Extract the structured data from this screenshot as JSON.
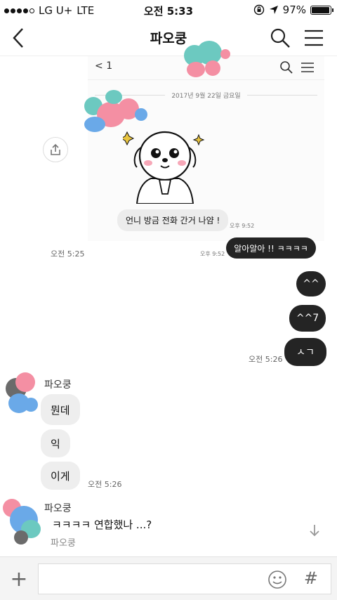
{
  "status": {
    "carrier": "LG U+",
    "network": "LTE",
    "time": "오전 5:33",
    "battery": "97%",
    "battery_level": 0.97
  },
  "header": {
    "title": "파오쿵"
  },
  "shot": {
    "back_label": "1",
    "date": "2017년 9월 22일 금요일",
    "incoming": "언니 방금 전화 간거 나얌 !",
    "incoming_time": "오후 9:52",
    "reply_time": "오후 9:52",
    "reply": "알아알아 !! ㅋㅋㅋㅋ"
  },
  "messages": {
    "shot_time": "오전 5:25",
    "mine": [
      "^^",
      "^^7",
      "ㅅㄱ"
    ],
    "mine_time": "오전 5:26",
    "sender": "파오쿵",
    "theirs": [
      "뭔데",
      "익",
      "이게"
    ],
    "theirs_time": "오전 5:26"
  },
  "preview": {
    "sender": "파오쿵",
    "text": "ㅋㅋㅋㅋ 연합했나 ...?",
    "name": "파오쿵"
  },
  "input": {
    "placeholder": "",
    "value": "",
    "hash": "#",
    "plus": "+"
  },
  "colors": {
    "dark_bubble": "#242424",
    "light_bubble": "#eeeeee",
    "accent_blob": "#6cc9c0"
  },
  "icons": [
    "back-chevron-icon",
    "search-icon",
    "menu-icon",
    "share-icon",
    "emoji-icon",
    "plus-icon",
    "scroll-down-icon"
  ]
}
